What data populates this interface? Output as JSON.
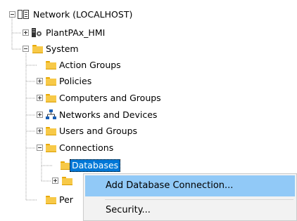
{
  "tree": {
    "nodes": [
      {
        "label": "Network (LOCALHOST)",
        "icon": "network-root-icon",
        "state": "expanded"
      },
      {
        "label": "PlantPAx_HMI",
        "icon": "server-icon",
        "state": "collapsed"
      },
      {
        "label": "System",
        "icon": "folder-icon",
        "state": "expanded"
      },
      {
        "label": "Action Groups",
        "icon": "folder-icon",
        "state": "leaf"
      },
      {
        "label": "Policies",
        "icon": "folder-icon",
        "state": "collapsed"
      },
      {
        "label": "Computers and Groups",
        "icon": "folder-icon",
        "state": "collapsed"
      },
      {
        "label": "Networks and Devices",
        "icon": "network-devices-icon",
        "state": "collapsed"
      },
      {
        "label": "Users and Groups",
        "icon": "folder-icon",
        "state": "collapsed"
      },
      {
        "label": "Connections",
        "icon": "folder-icon",
        "state": "expanded"
      },
      {
        "label": "Databases",
        "icon": "folder-icon",
        "state": "leaf",
        "selected": true
      },
      {
        "label": "",
        "icon": "folder-icon",
        "state": "collapsed"
      },
      {
        "label": "Per",
        "icon": "folder-icon",
        "state": "leaf"
      }
    ]
  },
  "context_menu": {
    "items": [
      {
        "label": "Add Database Connection...",
        "highlighted": true
      },
      {
        "label": "Security...",
        "highlighted": false
      }
    ]
  },
  "colors": {
    "selection": "#0078d7",
    "menu_highlight": "#91c9f7",
    "folder": "#f7c948"
  }
}
